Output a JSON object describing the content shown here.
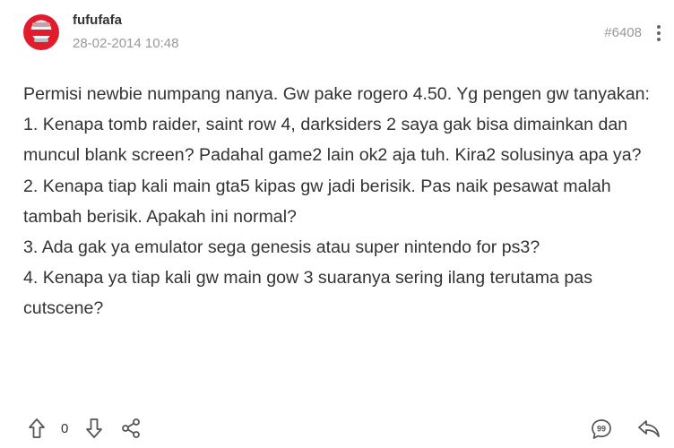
{
  "post": {
    "username": "fufufafa",
    "timestamp": "28-02-2014 10:48",
    "post_number": "#6408",
    "content_lines": [
      "Permisi newbie numpang nanya. Gw pake rogero 4.50. Yg pengen gw tanyakan:",
      "1. Kenapa tomb raider, saint row 4, darksiders 2 saya gak bisa dimainkan dan muncul blank screen? Padahal game2 lain ok2 aja tuh. Kira2 solusinya apa ya?",
      "2. Kenapa tiap kali main gta5 kipas gw jadi berisik. Pas naik pesawat malah tambah berisik. Apakah ini normal?",
      "3. Ada gak ya emulator sega genesis atau super nintendo for ps3?",
      "4. Kenapa ya tiap kali gw main gow 3 suaranya sering ilang terutama pas cutscene?"
    ],
    "vote_count": "0"
  },
  "icons": {
    "avatar": "avatar-image",
    "more": "more-vertical-icon",
    "upvote": "arrow-up-icon",
    "downvote": "arrow-down-icon",
    "share": "share-icon",
    "quote": "quote-icon",
    "reply": "reply-icon"
  },
  "colors": {
    "text": "#333333",
    "muted": "#999999",
    "icon": "#555555",
    "avatar_red": "#e21b2d"
  }
}
